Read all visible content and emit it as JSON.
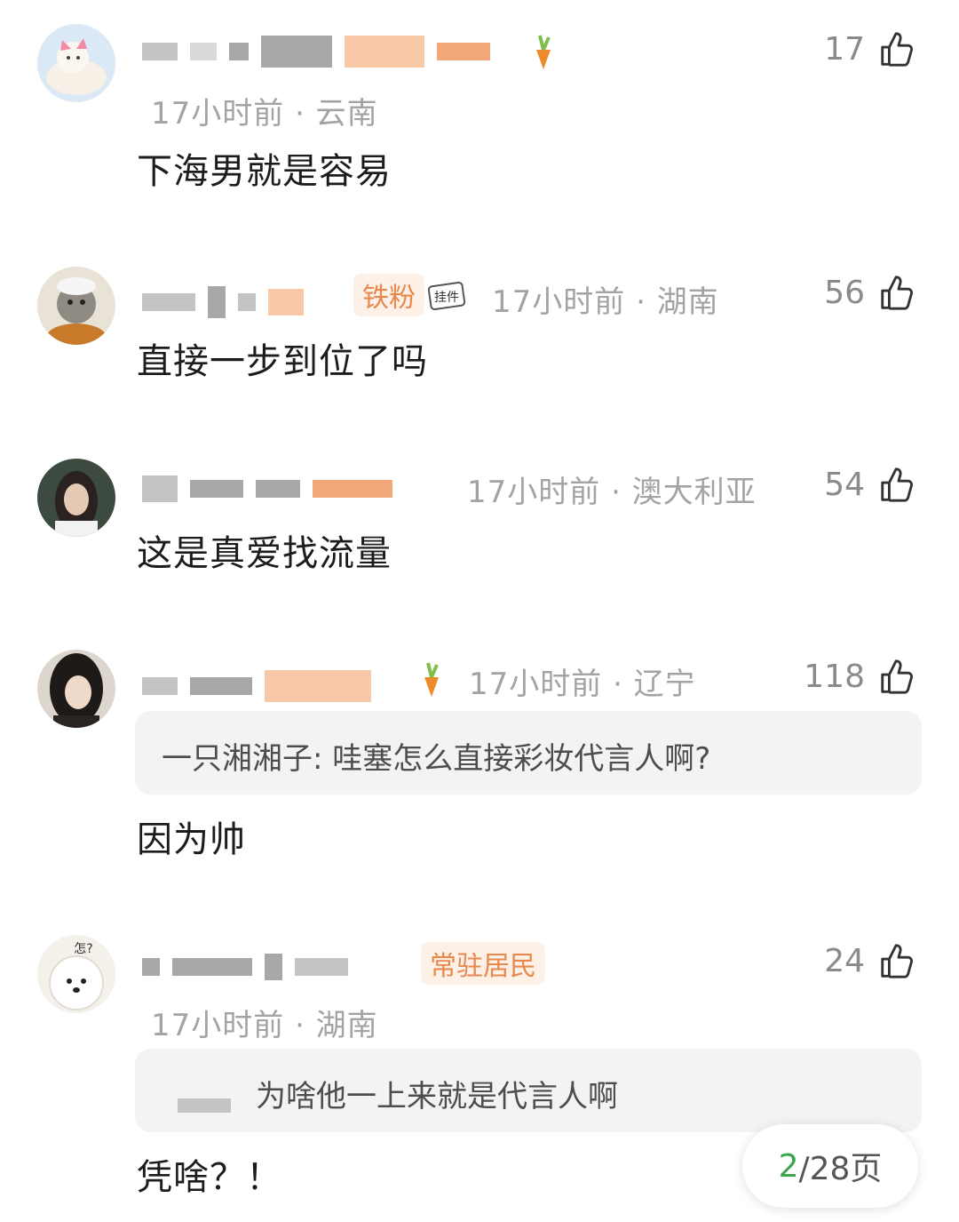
{
  "comments": [
    {
      "time_location": "17小时前 · 云南",
      "likes": "17",
      "text": "下海男就是容易"
    },
    {
      "badge": "铁粉",
      "pendant_label": "挂件",
      "time_location": "17小时前 · 湖南",
      "likes": "56",
      "text": "直接一步到位了吗"
    },
    {
      "time_location": "17小时前 · 澳大利亚",
      "likes": "54",
      "text": "这是真爱找流量"
    },
    {
      "time_location": "17小时前 · 辽宁",
      "likes": "118",
      "quote": "一只湘湘子: 哇塞怎么直接彩妆代言人啊?",
      "text": "因为帅"
    },
    {
      "badge": "常驻居民",
      "avatar_label": "怎?",
      "time_location": "17小时前 · 湖南",
      "likes": "24",
      "quote": "为啥他一上来就是代言人啊",
      "text": "凭啥？！"
    }
  ],
  "pager": {
    "current": "2",
    "total": "/28页"
  },
  "colors": {
    "page_bg": "#ffffff",
    "meta_gray": "#a3a3a3",
    "quote_bg": "#f3f3f3",
    "pager_current": "#3aa64a",
    "badge_orange": "#e8884d"
  },
  "icons": {
    "like": "thumb-up-icon",
    "pendant": "carrot-icon"
  }
}
